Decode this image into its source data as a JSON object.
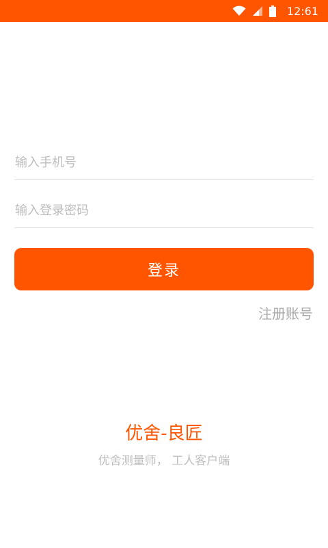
{
  "status_bar": {
    "time": "12:61",
    "background_color": "#ff5500",
    "icons": [
      "wifi-icon",
      "signal-icon",
      "battery-icon"
    ]
  },
  "login_form": {
    "phone_placeholder": "输入手机号",
    "phone_value": "",
    "password_placeholder": "输入登录密码",
    "password_value": "",
    "login_label": "登录",
    "register_label": "注册账号"
  },
  "branding": {
    "title": "优舍-良匠",
    "subtitle": "优舍测量师， 工人客户端"
  },
  "colors": {
    "accent": "#ff5500",
    "placeholder": "#bcbcbc",
    "divider": "#dddddd",
    "muted_text": "#a9a9a9"
  }
}
